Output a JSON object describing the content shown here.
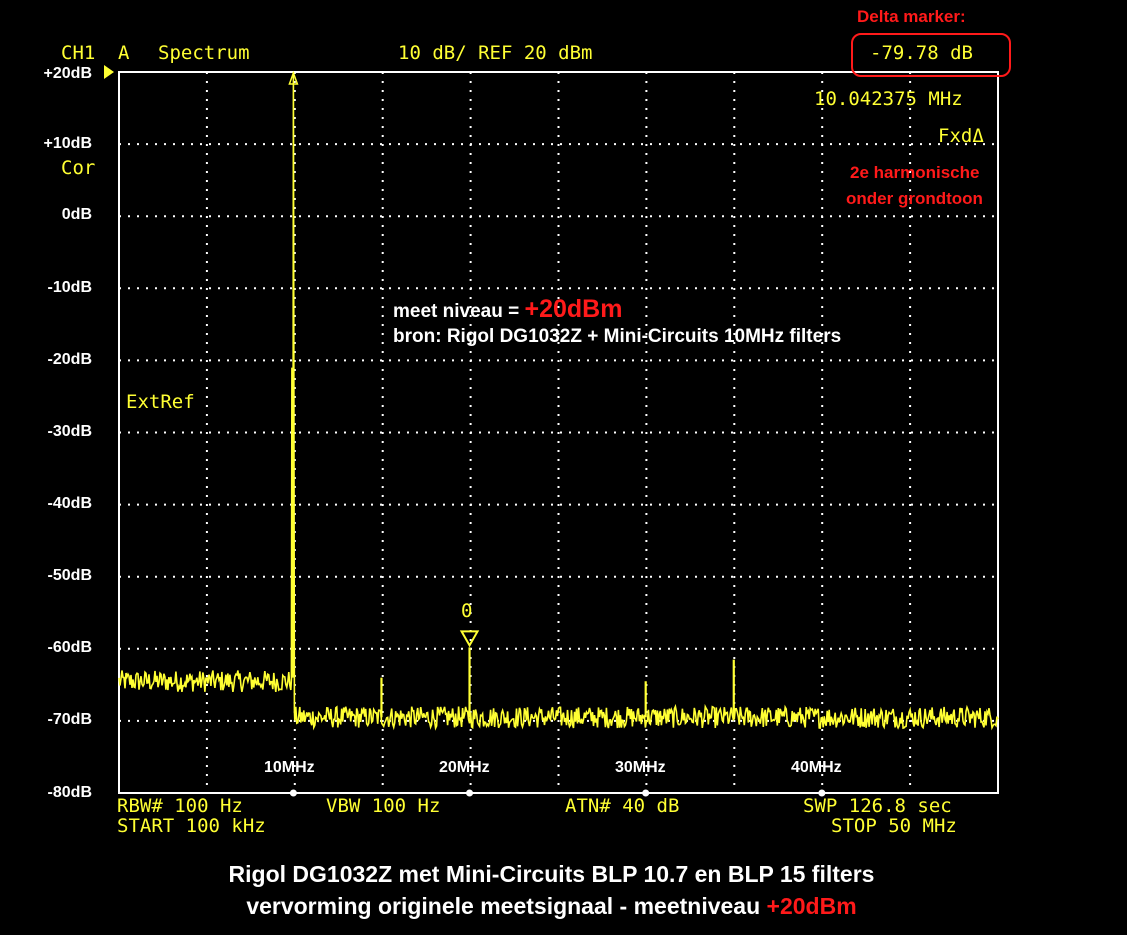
{
  "header": {
    "channel": "CH1",
    "trace": "A",
    "mode": "Spectrum",
    "scale": "10 dB/ REF 20 dBm",
    "delta_value": "-79.78 dB",
    "marker_freq": "10.042375 MHz",
    "marker_mode": "FxdΔ",
    "cor": "Cor",
    "extref": "ExtRef",
    "marker_label": "0"
  },
  "annotations": {
    "delta_title": "Delta marker:",
    "harmonic_line1": "2e harmonische",
    "harmonic_line2": "onder grondtoon",
    "meet_prefix": "meet niveau = ",
    "meet_value": "+20dBm",
    "bron": "bron: Rigol DG1032Z + Mini-Circuits 10MHz filters"
  },
  "footer": {
    "rbw": "RBW# 100 Hz",
    "vbw": "VBW 100 Hz",
    "atn": "ATN# 40 dB",
    "swp": "SWP  126.8 sec",
    "start": "START  100 kHz",
    "stop": "STOP  50 MHz"
  },
  "caption": {
    "line1": "Rigol DG1032Z met Mini-Circuits BLP 10.7 en BLP 15 filters",
    "line2_prefix": "vervorming originele meetsignaal - meetniveau ",
    "line2_value": "+20dBm"
  },
  "colors": {
    "trace": "#ffff33",
    "grid": "#ffffff",
    "accent_red": "#ff1a1a",
    "background": "#000000"
  },
  "chart_data": {
    "type": "line",
    "title": "",
    "xlabel": "",
    "ylabel": "",
    "xlim": [
      0.1,
      50
    ],
    "ylim": [
      -80,
      20
    ],
    "y_ticks": [
      "+20dB",
      "+10dB",
      "0dB",
      "-10dB",
      "-20dB",
      "-30dB",
      "-40dB",
      "-50dB",
      "-60dB",
      "-70dB",
      "-80dB"
    ],
    "x_ticks": [
      {
        "label": "10MHz",
        "value": 10
      },
      {
        "label": "20MHz",
        "value": 20
      },
      {
        "label": "30MHz",
        "value": 30
      },
      {
        "label": "40MHz",
        "value": 40
      }
    ],
    "grid": true,
    "noise_floor": {
      "below_10MHz": -64.5,
      "above_10MHz": -69.5
    },
    "peaks": [
      {
        "freq": 10.0,
        "level": 20.0,
        "note": "grondtoon"
      },
      {
        "freq": 15.0,
        "level": -64.0
      },
      {
        "freq": 20.0,
        "level": -59.8,
        "note": "2e harmonische"
      },
      {
        "freq": 30.0,
        "level": -64.5
      },
      {
        "freq": 35.0,
        "level": -61.5
      }
    ],
    "markers": [
      {
        "label": "Δ",
        "freq": 10.0,
        "level": 20.0
      },
      {
        "label": "0",
        "freq": 20.0,
        "level": -59.8
      }
    ]
  }
}
